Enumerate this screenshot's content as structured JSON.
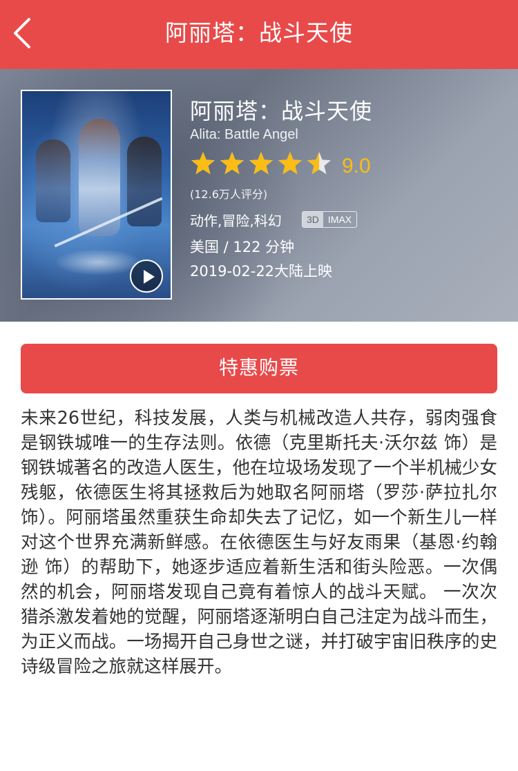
{
  "header": {
    "back_icon": "chevron-left-icon",
    "title": "阿丽塔：战斗天使"
  },
  "movie": {
    "title_cn": "阿丽塔：战斗天使",
    "title_en": "Alita: Battle Angel",
    "rating_stars": 4.5,
    "rating_max_stars": 5,
    "score": "9.0",
    "rating_count": "(12.6万人评分)",
    "genre": "动作,冒险,科幻",
    "tag_3d": "3D",
    "tag_imax": "IMAX",
    "country_duration": "美国 / 122 分钟",
    "release": "2019-02-22大陆上映",
    "play_icon": "play-icon"
  },
  "buy_button": "特惠购票",
  "synopsis": "未来26世纪，科技发展，人类与机械改造人共存，弱肉强食是钢铁城唯一的生存法则。依德（克里斯托夫·沃尔兹 饰）是钢铁城著名的改造人医生，他在垃圾场发现了一个半机械少女残躯，依德医生将其拯救后为她取名阿丽塔（罗莎·萨拉扎尔 饰）。阿丽塔虽然重获生命却失去了记忆，如一个新生儿一样对这个世界充满新鲜感。在依德医生与好友雨果（基恩·约翰逊 饰）的帮助下，她逐步适应着新生活和街头险恶。一次偶然的机会，阿丽塔发现自己竟有着惊人的战斗天赋。 一次次猎杀激发着她的觉醒，阿丽塔逐渐明白自己注定为战斗而生，为正义而战。一场揭开自己身世之谜，并打破宇宙旧秩序的史诗级冒险之旅就这样展开。",
  "colors": {
    "brand_red": "#e84a4a",
    "star_gold": "#fbbd13",
    "star_empty": "#e9e9ee"
  }
}
